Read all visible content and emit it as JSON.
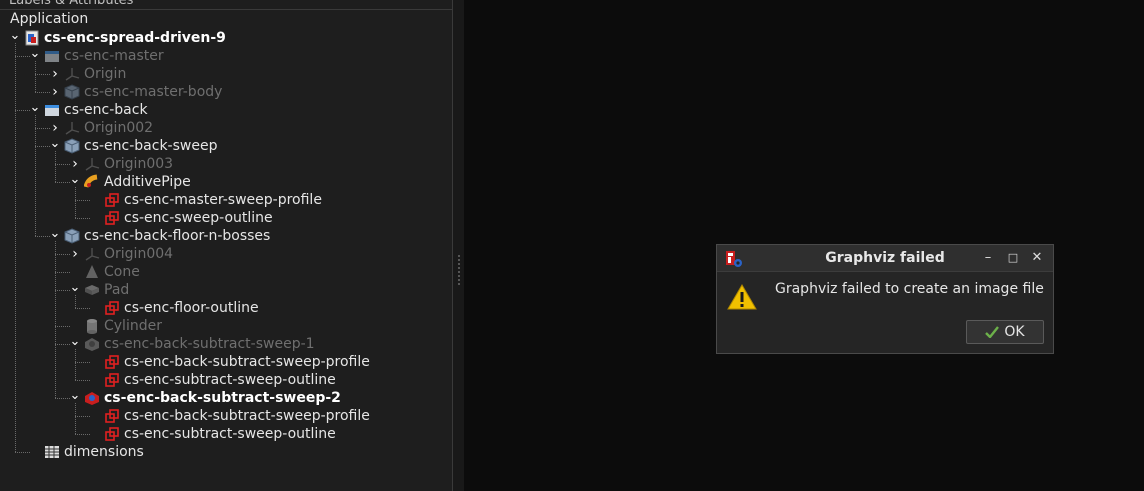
{
  "panel": {
    "header": "Labels & Attributes",
    "root_label": "Application"
  },
  "tree": [
    {
      "label": "cs-enc-spread-driven-9",
      "style": "bold",
      "icon": "document-icon",
      "arrow": "down",
      "depth": 0
    },
    {
      "label": "cs-enc-master",
      "style": "dim",
      "icon": "folder-icon",
      "arrow": "down",
      "depth": 1
    },
    {
      "label": "Origin",
      "style": "dim",
      "icon": "axis-icon",
      "arrow": "right",
      "depth": 2
    },
    {
      "label": "cs-enc-master-body",
      "style": "dim",
      "icon": "body-icon",
      "arrow": "right",
      "depth": 2
    },
    {
      "label": "cs-enc-back",
      "style": "norm",
      "icon": "folder-icon",
      "arrow": "down",
      "depth": 1
    },
    {
      "label": "Origin002",
      "style": "dim",
      "icon": "axis-icon",
      "arrow": "right",
      "depth": 2
    },
    {
      "label": "cs-enc-back-sweep",
      "style": "norm",
      "icon": "body-icon",
      "arrow": "down",
      "depth": 2
    },
    {
      "label": "Origin003",
      "style": "dim",
      "icon": "axis-icon",
      "arrow": "right",
      "depth": 3
    },
    {
      "label": "AdditivePipe",
      "style": "norm",
      "icon": "pipe-icon",
      "arrow": "down",
      "depth": 3
    },
    {
      "label": "cs-enc-master-sweep-profile",
      "style": "norm",
      "icon": "sketch-icon",
      "arrow": "none",
      "depth": 4
    },
    {
      "label": "cs-enc-sweep-outline",
      "style": "norm",
      "icon": "sketch-icon",
      "arrow": "none",
      "depth": 4
    },
    {
      "label": "cs-enc-back-floor-n-bosses",
      "style": "norm",
      "icon": "body-icon",
      "arrow": "down",
      "depth": 2
    },
    {
      "label": "Origin004",
      "style": "dim",
      "icon": "axis-icon",
      "arrow": "right",
      "depth": 3
    },
    {
      "label": "Cone",
      "style": "dim",
      "icon": "cone-icon",
      "arrow": "none",
      "depth": 3
    },
    {
      "label": "Pad",
      "style": "dim",
      "icon": "pad-icon",
      "arrow": "down",
      "depth": 3
    },
    {
      "label": "cs-enc-floor-outline",
      "style": "norm",
      "icon": "sketch-icon",
      "arrow": "none",
      "depth": 4
    },
    {
      "label": "Cylinder",
      "style": "dim",
      "icon": "cylinder-icon",
      "arrow": "none",
      "depth": 3
    },
    {
      "label": "cs-enc-back-subtract-sweep-1",
      "style": "dim",
      "icon": "subtract-icon",
      "arrow": "down",
      "depth": 3
    },
    {
      "label": "cs-enc-back-subtract-sweep-profile",
      "style": "norm",
      "icon": "sketch-icon",
      "arrow": "none",
      "depth": 4
    },
    {
      "label": "cs-enc-subtract-sweep-outline",
      "style": "norm",
      "icon": "sketch-icon",
      "arrow": "none",
      "depth": 4
    },
    {
      "label": "cs-enc-back-subtract-sweep-2",
      "style": "bold",
      "icon": "subtract-active-icon",
      "arrow": "down",
      "depth": 3
    },
    {
      "label": "cs-enc-back-subtract-sweep-profile",
      "style": "norm",
      "icon": "sketch-icon",
      "arrow": "none",
      "depth": 4
    },
    {
      "label": "cs-enc-subtract-sweep-outline",
      "style": "norm",
      "icon": "sketch-icon",
      "arrow": "none",
      "depth": 4
    },
    {
      "label": "dimensions",
      "style": "norm",
      "icon": "spreadsheet-icon",
      "arrow": "none",
      "depth": 1
    }
  ],
  "dialog": {
    "title": "Graphviz failed",
    "message": "Graphviz failed to create an image file",
    "ok_label": "OK",
    "minimize": "–",
    "maximize": "□",
    "close": "✕"
  },
  "colors": {
    "folder": "#3d8ee0",
    "body": "#8aa0b8",
    "sketch": "#e02020",
    "pipe": "#e8a020",
    "warning": "#f0c000"
  }
}
